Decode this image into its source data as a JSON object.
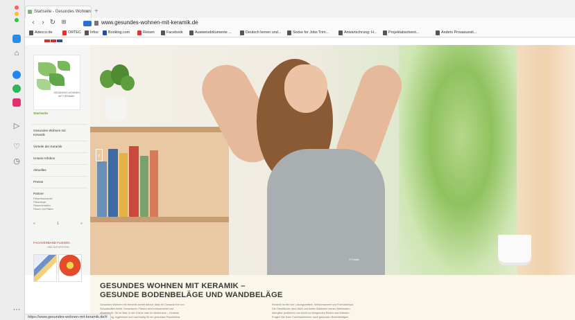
{
  "browser": {
    "tab_title": "Startseite - Gesundes Wohnen",
    "url": "www.gesundes-wohnen-mit-keramik.de",
    "status_url": "https://www.gesundes-wohnen-mit-keramik.de/#"
  },
  "bookmarks": [
    "Adecco.de",
    "ORTEC",
    "Infos",
    "Booking.com",
    "Reisen",
    "Facebook",
    "Ausweisdokumente ...",
    "Deutsch lernen und...",
    "Socke for Jobs Trim...",
    "Anwartschrung: H...",
    "Projektabsolvent...",
    "Anders Prosasuesti..."
  ],
  "logo": {
    "text": "GESUNDES WOHNEN MIT KERAMIK"
  },
  "nav": {
    "items": [
      "Startseite",
      "Gesundes Wohnen mit Keramik",
      "Vorteile der Keramik",
      "Unsere Infobox",
      "Aktuelles",
      "Presse",
      "Partner"
    ],
    "sub_items": [
      "Fliesenfachhandel",
      "Fliesenleger",
      "Fliesenhersteller",
      "Fliesen und Platten"
    ],
    "pager": [
      "«",
      "1",
      "»"
    ]
  },
  "partner": {
    "title": "FACHVERBAND FLIESEN",
    "subtitle": "UND NATURSTEIN"
  },
  "hero": {
    "caption": "© Fotolia"
  },
  "content": {
    "heading_1": "GESUNDES WOHNEN MIT KERAMIK –",
    "heading_2": "GESUNDE BODENBELÄGE UND WANDBELÄGE",
    "col1": [
      "Gesundes Wohnen mit Keramik achtet darauf, dass Ihr Zuhause frei von",
      "Schadstoffen bleibt. Keramische Fliesen sind emissionsfrei und",
      "pflegeleicht. Ob im Bad, in der Küche oder im Wohnraum – Keramik",
      "ist langlebig, hygienisch und nachhaltig für ein gesundes Raumklima."
    ],
    "col2": [
      "Keramik ist frei von Lösungsmitteln, Weichmachern und Formaldehyd.",
      "Die Oberflächen sind dicht und bieten Bakterien keinen Nährboden.",
      "Allergiker profitieren von leicht zu reinigenden Böden und Wänden.",
      "Fragen Sie Ihren Fachhandwerker nach gesunden Bodenbelägen."
    ]
  },
  "colors": {
    "accent_green": "#6d9d3a",
    "partner_red": "#c0392b",
    "shield_blue": "#2b6fd6"
  }
}
